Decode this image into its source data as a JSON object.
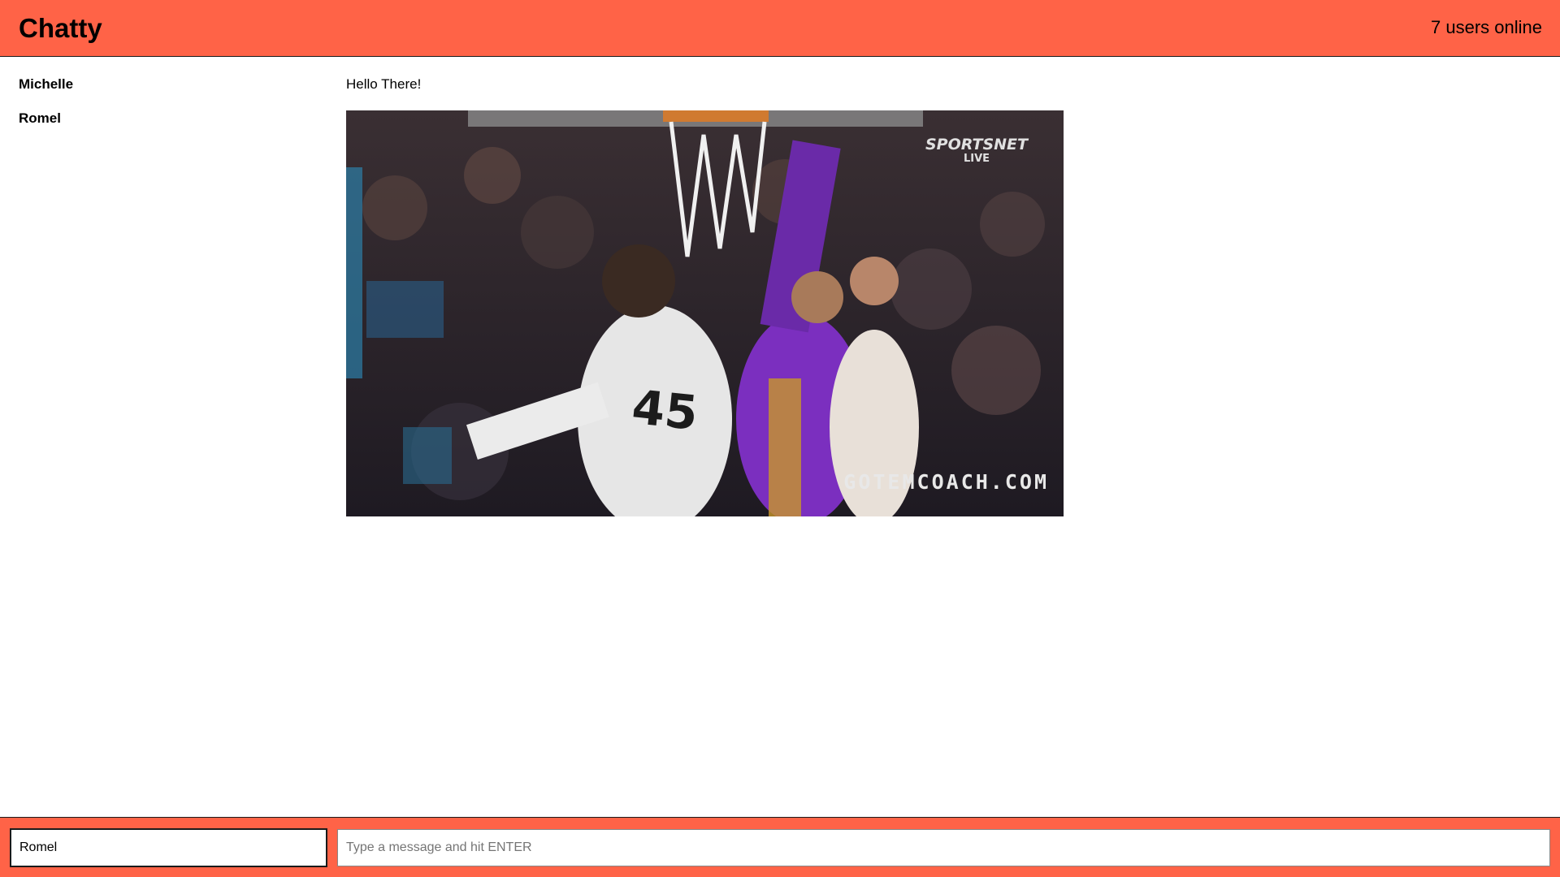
{
  "header": {
    "brand": "Chatty",
    "online_status": "7 users online"
  },
  "messages": [
    {
      "username": "Michelle",
      "content": "Hello There!",
      "type": "text"
    },
    {
      "username": "Romel",
      "content": "",
      "type": "image"
    }
  ],
  "image": {
    "watermark": "GOTEMCOACH.COM",
    "broadcast_logo": "SPORTSNET",
    "broadcast_sub": "LIVE",
    "jersey_number": "45"
  },
  "footer": {
    "username_value": "Romel",
    "message_placeholder": "Type a message and hit ENTER"
  },
  "colors": {
    "accent": "#ff6347"
  }
}
